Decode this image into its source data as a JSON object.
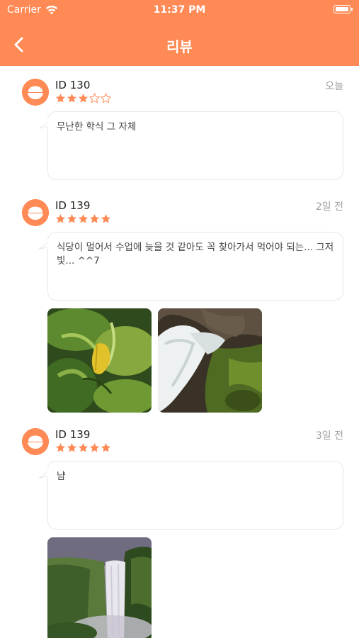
{
  "status_bar": {
    "carrier": "Carrier",
    "time": "11:37 PM"
  },
  "nav": {
    "title": "리뷰",
    "back_icon": "chevron-left-icon"
  },
  "colors": {
    "accent": "#FF8A55",
    "star": "#FF8A55",
    "date": "#a0a0a0"
  },
  "reviews": [
    {
      "user": "ID 130",
      "rating": 3,
      "max_rating": 5,
      "date": "오늘",
      "text": "무난한 학식 그 자체",
      "photos": []
    },
    {
      "user": "ID 139",
      "rating": 5,
      "max_rating": 5,
      "date": "2일 전",
      "text": "식당이 멀어서 수업에 늦을 것 같아도 꼭 찾아가서 먹어야 되는... 그저 빛... ^^7",
      "photos": [
        "leaf-photo",
        "waterfall-rocks-photo"
      ]
    },
    {
      "user": "ID 139",
      "rating": 5,
      "max_rating": 5,
      "date": "3일 전",
      "text": "냠",
      "photos": [
        "waterfall-cliff-photo"
      ]
    }
  ]
}
